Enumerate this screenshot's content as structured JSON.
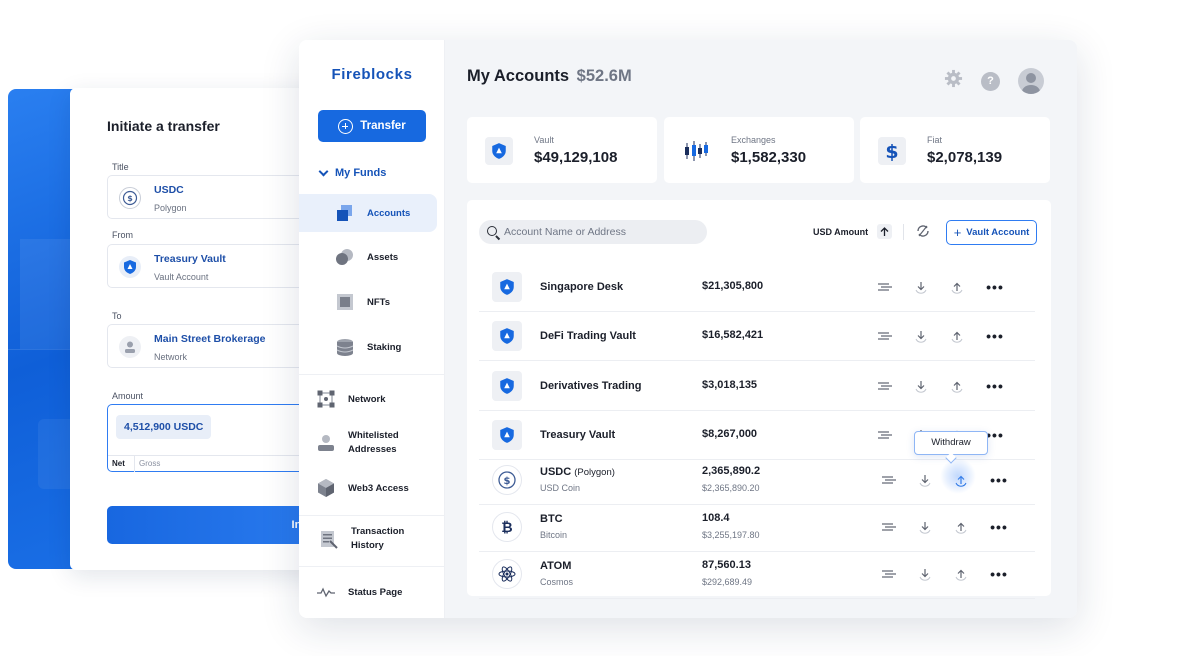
{
  "transfer_form": {
    "title": "Initiate a transfer",
    "asset_label": "Title",
    "asset": {
      "name": "USDC",
      "network": "Polygon"
    },
    "from_label": "From",
    "from": {
      "name": "Treasury Vault",
      "type": "Vault Account"
    },
    "to_label": "To",
    "to": {
      "name": "Main Street Brokerage",
      "type": "Network"
    },
    "amount_label": "Amount",
    "amount_value": "4,512,900 USDC",
    "amount_mode_net": "Net",
    "amount_mode_gross": "Gross",
    "submit_label": "Initiate"
  },
  "sidebar": {
    "logo": "Fireblocks",
    "transfer_button": "Transfer",
    "section": "My Funds",
    "items": [
      {
        "label": "Accounts",
        "icon": "accounts-icon",
        "active": true
      },
      {
        "label": "Assets",
        "icon": "assets-icon"
      },
      {
        "label": "NFTs",
        "icon": "nfts-icon"
      },
      {
        "label": "Staking",
        "icon": "staking-icon"
      },
      {
        "label": "Network",
        "icon": "network-icon"
      },
      {
        "label": "Whitelisted Addresses",
        "icon": "whitelist-icon"
      },
      {
        "label": "Web3 Access",
        "icon": "web3-icon"
      },
      {
        "label": "Transaction History",
        "icon": "history-icon"
      },
      {
        "label": "Status Page",
        "icon": "status-icon"
      }
    ]
  },
  "header": {
    "title": "My Accounts",
    "total": "$52.6M",
    "icons": [
      "gear-icon",
      "help-icon",
      "avatar"
    ]
  },
  "stats": [
    {
      "label": "Vault",
      "value": "$49,129,108",
      "icon": "vault-shield-icon"
    },
    {
      "label": "Exchanges",
      "value": "$1,582,330",
      "icon": "candlestick-icon"
    },
    {
      "label": "Fiat",
      "value": "$2,078,139",
      "icon": "dollar-icon"
    }
  ],
  "table": {
    "search_placeholder": "Account Name or Address",
    "sort_label": "USD Amount",
    "add_button": "Vault Account",
    "tooltip": "Withdraw",
    "rows": [
      {
        "name": "Singapore Desk",
        "amount": "$21,305,800",
        "kind": "vault"
      },
      {
        "name": "DeFi Trading Vault",
        "amount": "$16,582,421",
        "kind": "vault"
      },
      {
        "name": "Derivatives Trading",
        "amount": "$3,018,135",
        "kind": "vault"
      },
      {
        "name": "Treasury Vault",
        "amount": "$8,267,000",
        "kind": "vault"
      },
      {
        "name": "USDC",
        "chain": "(Polygon)",
        "sub": "USD Coin",
        "amount": "2,365,890.2",
        "usd": "$2,365,890.20",
        "kind": "usdc"
      },
      {
        "name": "BTC",
        "sub": "Bitcoin",
        "amount": "108.4",
        "usd": "$3,255,197.80",
        "kind": "btc"
      },
      {
        "name": "ATOM",
        "sub": "Cosmos",
        "amount": "87,560.13",
        "usd": "$292,689.49",
        "kind": "atom"
      }
    ]
  },
  "colors": {
    "brand_blue": "#1769e0",
    "link_blue": "#1553b8",
    "content_bg": "#f3f5f8"
  }
}
